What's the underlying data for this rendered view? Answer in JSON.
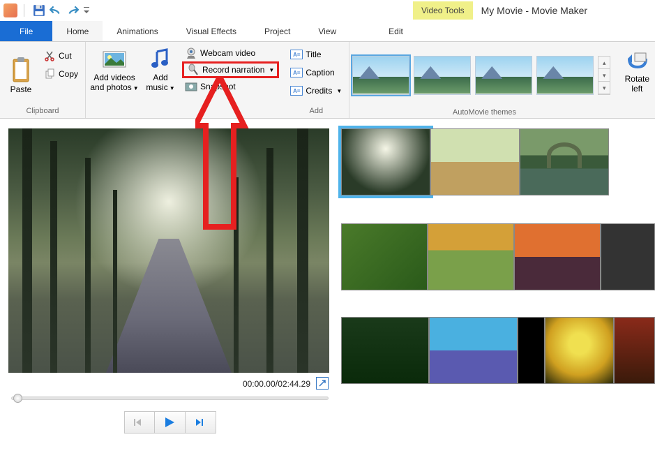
{
  "window": {
    "video_tools": "Video Tools",
    "title": "My Movie - Movie Maker"
  },
  "tabs": {
    "file": "File",
    "home": "Home",
    "animations": "Animations",
    "visual_effects": "Visual Effects",
    "project": "Project",
    "view": "View",
    "edit": "Edit"
  },
  "ribbon": {
    "clipboard": {
      "paste": "Paste",
      "cut": "Cut",
      "copy": "Copy",
      "group_label": "Clipboard"
    },
    "add": {
      "photos": "Add videos\nand photos",
      "music": "Add\nmusic",
      "webcam": "Webcam video",
      "record_narration": "Record narration",
      "snapshot": "Snapshot",
      "title": "Title",
      "caption": "Caption",
      "credits": "Credits",
      "group_label": "Add"
    },
    "themes": {
      "group_label": "AutoMovie themes"
    },
    "rotate": {
      "left": "Rotate\nleft"
    }
  },
  "preview": {
    "time_current": "00:00.00",
    "time_total": "02:44.29"
  },
  "icons": {
    "save": "save-icon",
    "undo": "undo-icon",
    "redo": "redo-icon",
    "qat_more": "qat-more-icon",
    "scissors": "scissors-icon",
    "copy": "copy-icon",
    "clipboard": "clipboard-icon",
    "photo": "photo-icon",
    "music": "music-note-icon",
    "webcam": "webcam-icon",
    "mic": "microphone-icon",
    "snapshot": "snapshot-icon",
    "title": "title-icon",
    "caption": "caption-icon",
    "credits": "credits-icon",
    "rotate": "rotate-left-icon",
    "expand": "expand-icon",
    "prev": "step-back-icon",
    "play": "play-icon",
    "next": "step-forward-icon"
  }
}
